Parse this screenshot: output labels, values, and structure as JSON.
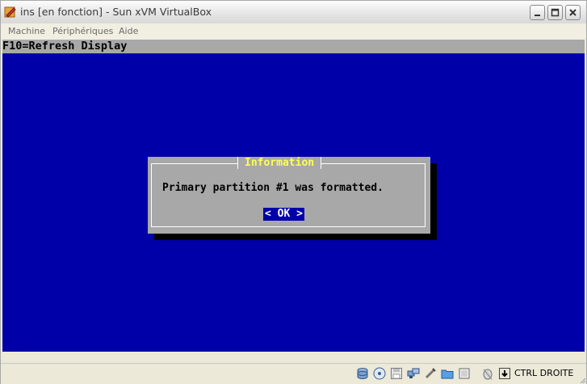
{
  "window": {
    "title": "ins [en fonction] - Sun xVM VirtualBox",
    "icon": "virtualbox-app-icon"
  },
  "menu": {
    "items": [
      {
        "label": "Machine"
      },
      {
        "label": "Périphériques"
      },
      {
        "label": "Aide"
      }
    ]
  },
  "guest": {
    "top_bar_text": "F10=Refresh Display",
    "dialog": {
      "title": "Information",
      "message": "Primary partition #1 was formatted.",
      "ok_label": "< OK >"
    },
    "colors": {
      "background": "#0000a8",
      "panel": "#a8a8a8",
      "title": "#ffff54"
    }
  },
  "statusbar": {
    "icons": [
      "hard-disk-icon",
      "cd-dvd-icon",
      "floppy-icon",
      "network-icon",
      "usb-icon",
      "shared-folders-icon",
      "display-icon",
      "mouse-integration-icon",
      "host-key-icon"
    ],
    "host_key_label": "CTRL DROITE"
  }
}
